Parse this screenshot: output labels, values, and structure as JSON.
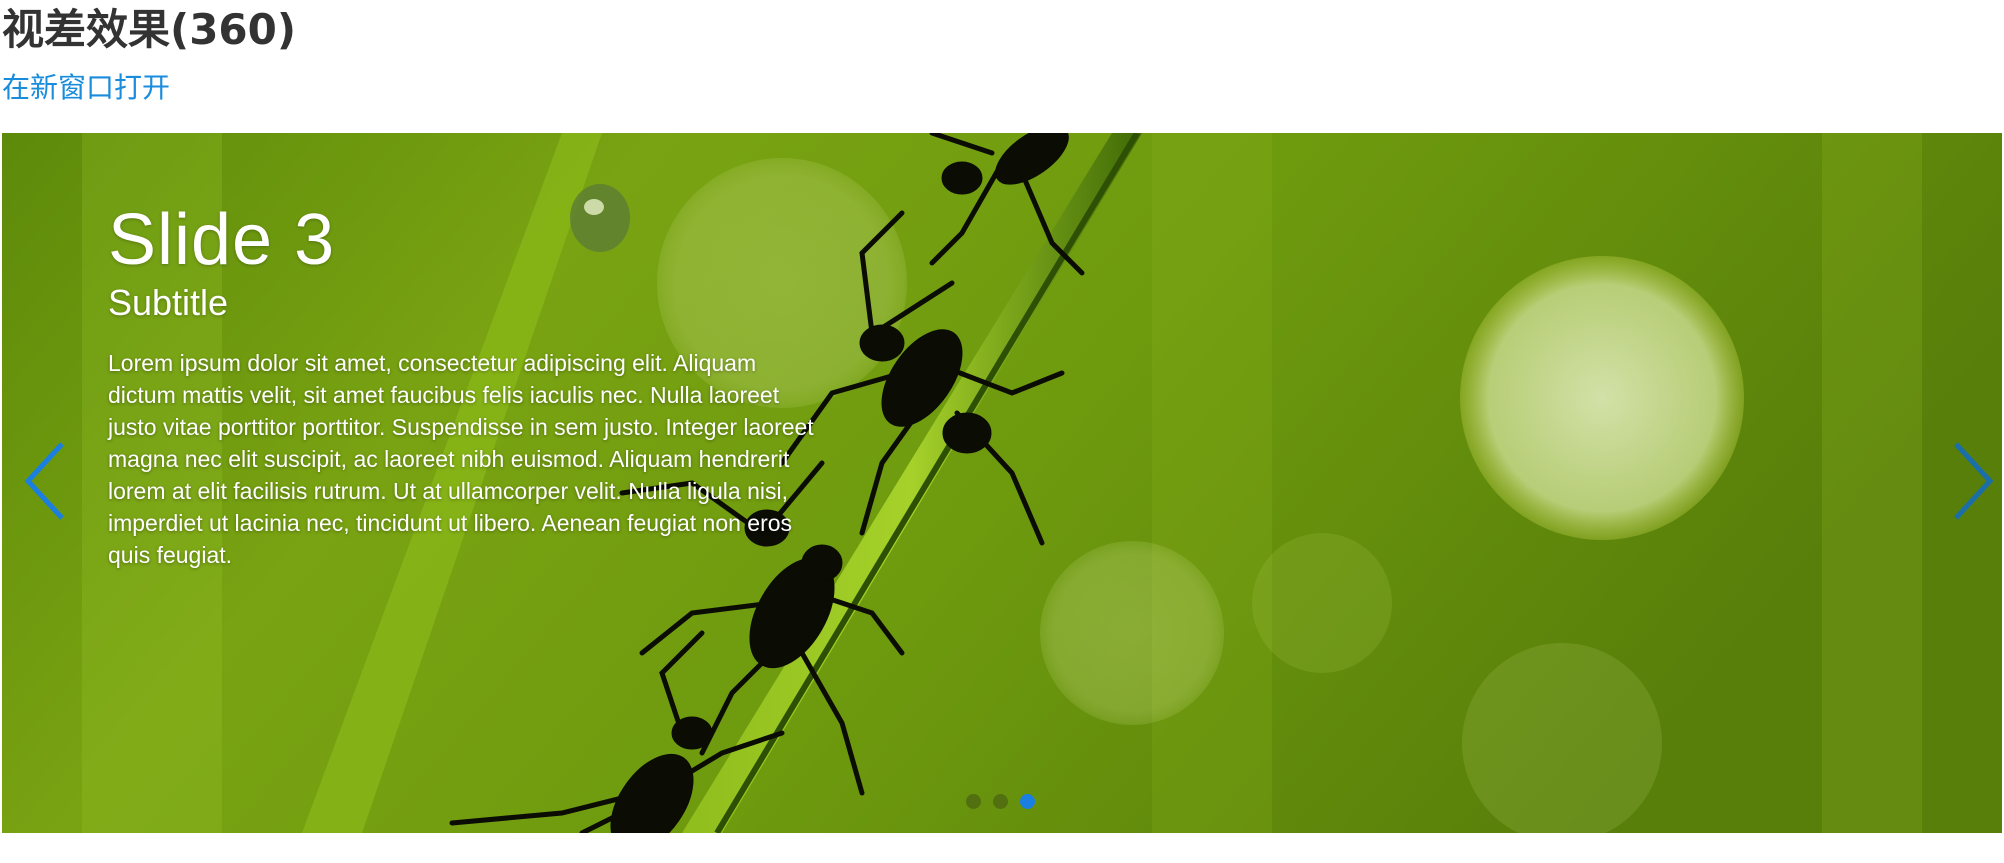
{
  "page": {
    "title": "视差效果(360)",
    "open_link": "在新窗口打开"
  },
  "slider": {
    "current_slide": 3,
    "total_slides": 3,
    "slide": {
      "title": "Slide 3",
      "subtitle": "Subtitle",
      "text": "Lorem ipsum dolor sit amet, consectetur adipiscing elit. Aliquam dictum mattis velit, sit amet faucibus felis iaculis nec. Nulla laoreet justo vitae porttitor porttitor. Suspendisse in sem justo. Integer laoreet magna nec elit suscipit, ac laoreet nibh euismod. Aliquam hendrerit lorem at elit facilisis rutrum. Ut at ullamcorper velit. Nulla ligula nisi, imperdiet ut lacinia nec, tincidunt ut libero. Aenean feugiat non eros quis feugiat."
    },
    "prev_icon": "chevron-left-icon",
    "next_icon": "chevron-right-icon",
    "colors": {
      "link": "#1a8cdc",
      "arrow": "#1a7fe0",
      "active_dot": "#1a7fe0",
      "background": "#6f9a10"
    }
  }
}
